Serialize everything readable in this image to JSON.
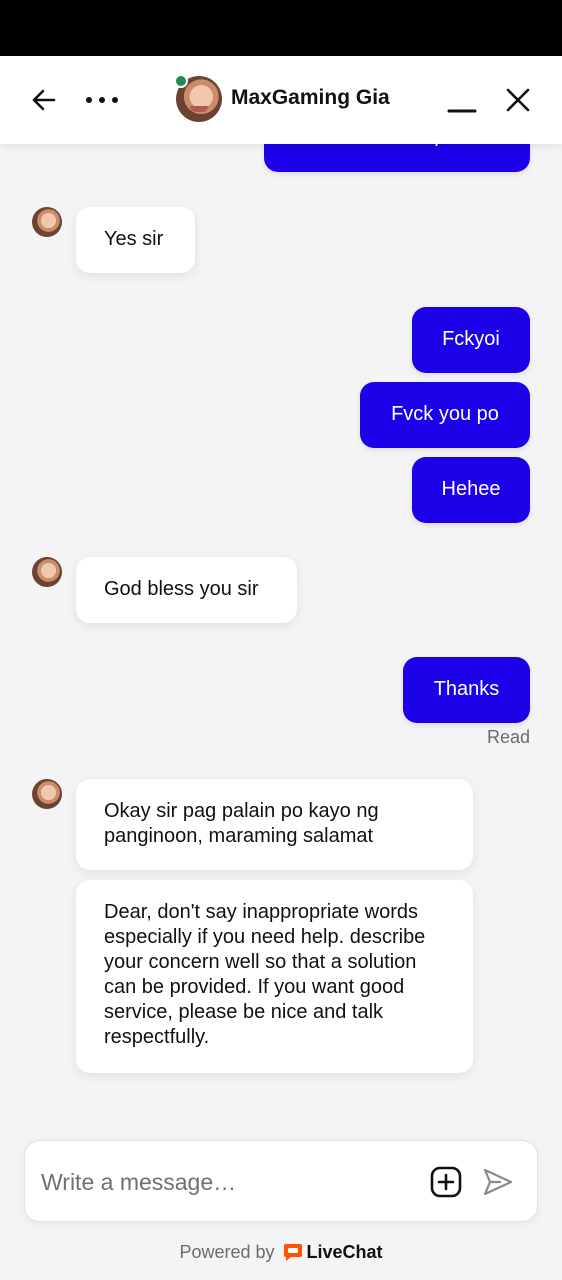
{
  "header": {
    "agent_name": "MaxGaming Gia",
    "icons": {
      "back": "arrow-left-icon",
      "more": "more-dots-icon",
      "minimize": "minimize-icon",
      "close": "close-icon"
    },
    "status_color": "#1f8a53"
  },
  "messages": [
    {
      "from": "user",
      "text": "So i need to depo first"
    },
    {
      "from": "agent",
      "text": "Yes sir"
    },
    {
      "from": "user",
      "text": "Fckyoi"
    },
    {
      "from": "user",
      "text": "Fvck you po"
    },
    {
      "from": "user",
      "text": "Hehee"
    },
    {
      "from": "agent",
      "text": "God bless you sir"
    },
    {
      "from": "user",
      "text": "Thanks"
    },
    {
      "from": "agent",
      "text": "Okay sir pag palain po kayo ng panginoon, maraming salamat"
    },
    {
      "from": "agent",
      "text": "Dear, don't say inappropriate words especially if you need help. describe your concern well so that a solution can be provided. If you want good service, please be nice and talk respectfully."
    }
  ],
  "read_status": "Read",
  "composer": {
    "placeholder": "Write a message…",
    "attach_icon": "add-attachment-icon",
    "send_icon": "send-icon"
  },
  "footer": {
    "powered_by": "Powered by",
    "brand": "LiveChat",
    "brand_color": "#ff5100"
  },
  "colors": {
    "outgoing_bubble": "#1c00e8",
    "incoming_bubble": "#ffffff",
    "background": "#f4f4f6"
  }
}
